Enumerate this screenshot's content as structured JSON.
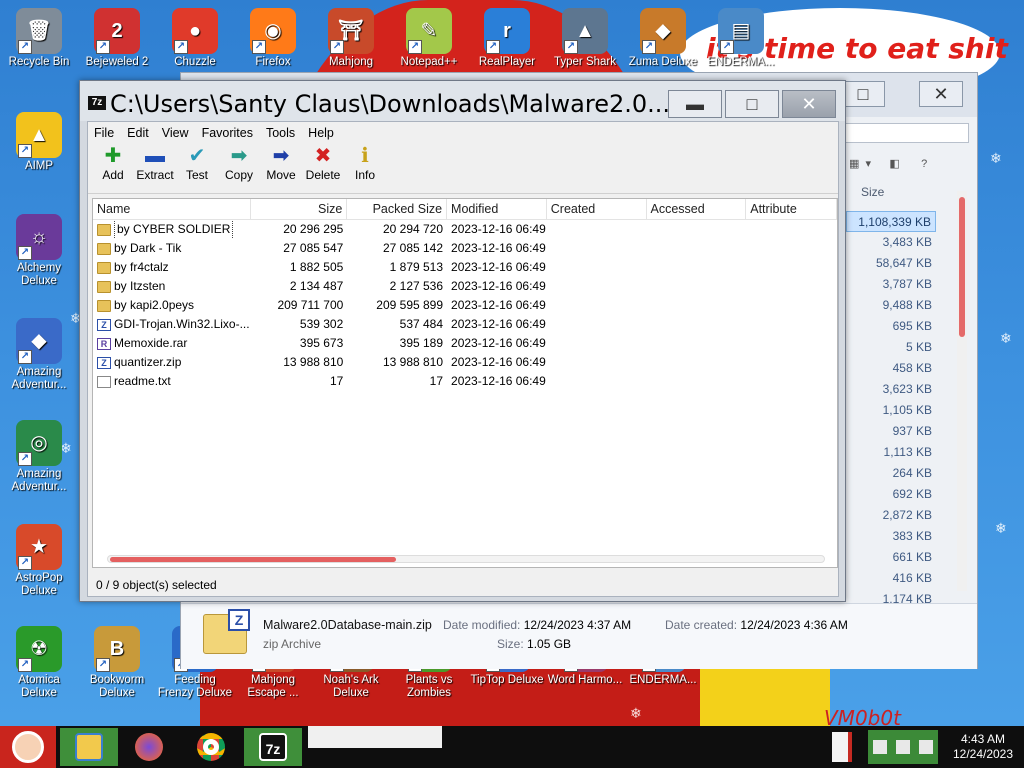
{
  "desktop": {
    "wallpaper_text": "it's time to eat shit",
    "corner_text": "VM0b0t",
    "icons_top": [
      {
        "label": "Recycle Bin",
        "color": "#7f8c99",
        "glyph": "🗑"
      },
      {
        "label": "Bejeweled 2",
        "color": "#d03131",
        "glyph": "2"
      },
      {
        "label": "Chuzzle",
        "color": "#e03a2a",
        "glyph": "●"
      },
      {
        "label": "Firefox",
        "color": "#ff7a18",
        "glyph": "◉"
      },
      {
        "label": "Mahjong",
        "color": "#c84a2a",
        "glyph": "⛩"
      },
      {
        "label": "Notepad++",
        "color": "#a3c84a",
        "glyph": "✎"
      },
      {
        "label": "RealPlayer",
        "color": "#2a7fd8",
        "glyph": "r"
      },
      {
        "label": "Typer Shark",
        "color": "#5d7690",
        "glyph": "▲"
      },
      {
        "label": "Zuma Deluxe",
        "color": "#c87a2a",
        "glyph": "◆"
      },
      {
        "label": "ENDERMA...",
        "color": "#4a8ac8",
        "glyph": "▤"
      }
    ],
    "icons_left": [
      {
        "label": "AIMP",
        "color": "#f2c21c",
        "glyph": "▲"
      },
      {
        "label": "Alchemy Deluxe",
        "color": "#6a3a9a",
        "glyph": "☼"
      },
      {
        "label": "Amazing Adventur...",
        "color": "#3a6ac8",
        "glyph": "◆"
      },
      {
        "label": "Amazing Adventur...",
        "color": "#2a8a4a",
        "glyph": "◎"
      },
      {
        "label": "AstroPop Deluxe",
        "color": "#d84a2a",
        "glyph": "★"
      },
      {
        "label": "Atomica Deluxe",
        "color": "#2a9a2a",
        "glyph": "☢"
      }
    ],
    "icons_bottom": [
      {
        "label": "Bookworm Deluxe",
        "color": "#c89a3a",
        "glyph": "B"
      },
      {
        "label": "Feeding Frenzy Deluxe",
        "color": "#2a6ac8",
        "glyph": "◐"
      },
      {
        "label": "Mahjong Escape ...",
        "color": "#c84a2a",
        "glyph": "⛩"
      },
      {
        "label": "Noah's Ark Deluxe",
        "color": "#8a5a2a",
        "glyph": "⛵"
      },
      {
        "label": "Plants vs Zombies",
        "color": "#4a9a2a",
        "glyph": "✿"
      },
      {
        "label": "TipTop Deluxe",
        "color": "#3a6ac8",
        "glyph": "▲"
      },
      {
        "label": "Word Harmo...",
        "color": "#9a3a6a",
        "glyph": "W"
      },
      {
        "label": "ENDERMA...",
        "color": "#4a8ac8",
        "glyph": "▤"
      }
    ]
  },
  "explorer": {
    "size_header": "Size",
    "sizes": [
      "1,108,339 KB",
      "3,483 KB",
      "58,647 KB",
      "3,787 KB",
      "9,488 KB",
      "695 KB",
      "5 KB",
      "458 KB",
      "3,623 KB",
      "1,105 KB",
      "937 KB",
      "1,113 KB",
      "264 KB",
      "692 KB",
      "2,872 KB",
      "383 KB",
      "661 KB",
      "416 KB",
      "1,174 KB"
    ],
    "details": {
      "file_name": "Malware2.0Database-main.zip",
      "file_type": "zip Archive",
      "date_modified_label": "Date modified:",
      "date_modified": "12/24/2023 4:37 AM",
      "date_created_label": "Date created:",
      "date_created": "12/24/2023 4:36 AM",
      "size_label": "Size:",
      "size": "1.05 GB"
    }
  },
  "zip_window": {
    "title": "C:\\Users\\Santy Claus\\Downloads\\Malware2.0...",
    "menu": [
      "File",
      "Edit",
      "View",
      "Favorites",
      "Tools",
      "Help"
    ],
    "toolbar": [
      {
        "label": "Add",
        "glyph": "✚",
        "color": "#1f9a2a",
        "icon": "add-icon"
      },
      {
        "label": "Extract",
        "glyph": "▬",
        "color": "#1f4fb8",
        "icon": "extract-icon"
      },
      {
        "label": "Test",
        "glyph": "✔",
        "color": "#2a9ab8",
        "icon": "test-icon"
      },
      {
        "label": "Copy",
        "glyph": "➡",
        "color": "#2a9a8a",
        "icon": "copy-icon"
      },
      {
        "label": "Move",
        "glyph": "➡",
        "color": "#1f3fa8",
        "icon": "move-icon"
      },
      {
        "label": "Delete",
        "glyph": "✖",
        "color": "#d32222",
        "icon": "delete-icon"
      },
      {
        "label": "Info",
        "glyph": "ℹ",
        "color": "#c8a21a",
        "icon": "info-icon"
      }
    ],
    "columns": [
      "Name",
      "Size",
      "Packed Size",
      "Modified",
      "Created",
      "Accessed",
      "Attribute"
    ],
    "rows": [
      {
        "type": "folder",
        "name": "by CYBER SOLDIER",
        "size": "20 296 295",
        "packed": "20 294 720",
        "modified": "2023-12-16 06:49"
      },
      {
        "type": "folder",
        "name": "by Dark - Tik",
        "size": "27 085 547",
        "packed": "27 085 142",
        "modified": "2023-12-16 06:49"
      },
      {
        "type": "folder",
        "name": "by fr4ctalz",
        "size": "1 882 505",
        "packed": "1 879 513",
        "modified": "2023-12-16 06:49"
      },
      {
        "type": "folder",
        "name": "by Itzsten",
        "size": "2 134 487",
        "packed": "2 127 536",
        "modified": "2023-12-16 06:49"
      },
      {
        "type": "folder",
        "name": "by kapi2.0peys",
        "size": "209 711 700",
        "packed": "209 595 899",
        "modified": "2023-12-16 06:49"
      },
      {
        "type": "zip",
        "name": "GDI-Trojan.Win32.Lixo-...",
        "size": "539 302",
        "packed": "537 484",
        "modified": "2023-12-16 06:49"
      },
      {
        "type": "rar",
        "name": "Memoxide.rar",
        "size": "395 673",
        "packed": "395 189",
        "modified": "2023-12-16 06:49"
      },
      {
        "type": "zip",
        "name": "quantizer.zip",
        "size": "13 988 810",
        "packed": "13 988 810",
        "modified": "2023-12-16 06:49"
      },
      {
        "type": "txt",
        "name": "readme.txt",
        "size": "17",
        "packed": "17",
        "modified": "2023-12-16 06:49"
      }
    ],
    "status": "0 / 9 object(s) selected"
  },
  "taskbar": {
    "time": "4:43 AM",
    "date": "12/24/2023",
    "zip_label": "7z"
  },
  "colors": {
    "accent_green": "#3f8f3a",
    "scroll_red": "#e46060"
  }
}
